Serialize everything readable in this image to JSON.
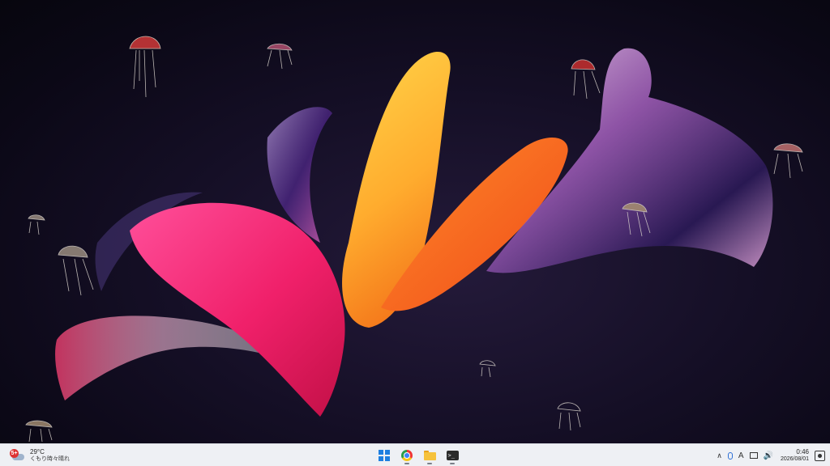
{
  "taskbar": {
    "weather": {
      "badge": "5+",
      "temperature": "29°C",
      "description": "くもり時々晴れ",
      "icon": "cloud-icon"
    },
    "apps": [
      {
        "name": "start",
        "icon": "windows-logo-icon"
      },
      {
        "name": "chrome",
        "icon": "chrome-icon"
      },
      {
        "name": "file-explorer",
        "icon": "folder-icon"
      },
      {
        "name": "terminal",
        "icon": "terminal-icon",
        "glyph": ">_"
      }
    ],
    "tray": {
      "chevron": "∧",
      "ime": "A",
      "speaker": "🔊",
      "time": "0:46",
      "date": "2026/08/01"
    }
  },
  "colors": {
    "taskbar_bg": "#eef0f4",
    "desktop_bg": "#0b0816",
    "accent": "#1e7fe0"
  }
}
